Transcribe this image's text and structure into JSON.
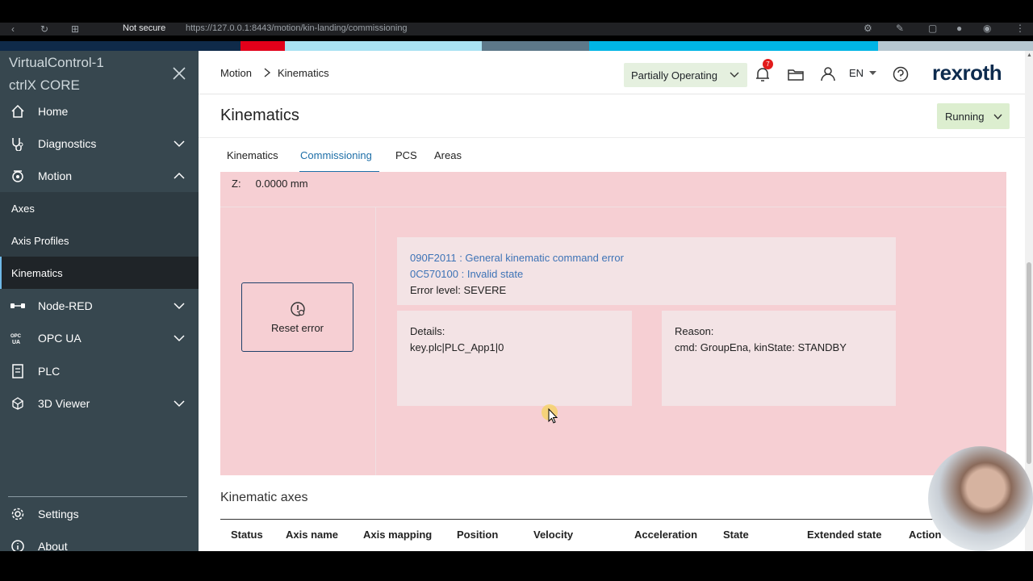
{
  "browser": {
    "secure_label": "Not secure",
    "url": "https://127.0.0.1:8443/motion/kin-landing/commissioning"
  },
  "sidebar": {
    "title_line1": "VirtualControl-1",
    "title_line2": "ctrlX CORE",
    "items": [
      {
        "label": "Home",
        "icon": "home-icon"
      },
      {
        "label": "Diagnostics",
        "icon": "stethoscope-icon"
      },
      {
        "label": "Motion",
        "icon": "motion-icon"
      },
      {
        "label": "Node-RED",
        "icon": "node-red-icon"
      },
      {
        "label": "OPC UA",
        "icon": "opc-ua-icon"
      },
      {
        "label": "PLC",
        "icon": "plc-icon"
      },
      {
        "label": "3D Viewer",
        "icon": "3d-viewer-icon"
      }
    ],
    "motion_sub": [
      "Axes",
      "Axis Profiles",
      "Kinematics"
    ],
    "footer": [
      {
        "label": "Settings",
        "icon": "gear-icon"
      },
      {
        "label": "About",
        "icon": "info-icon"
      }
    ]
  },
  "header": {
    "breadcrumb": [
      "Motion",
      "Kinematics"
    ],
    "operating_state": "Partially Operating",
    "notifications_count": "7",
    "language": "EN",
    "brand": "rexroth"
  },
  "page": {
    "title": "Kinematics",
    "run_state": "Running",
    "tabs": [
      "Kinematics",
      "Commissioning",
      "PCS",
      "Areas"
    ],
    "active_tab": "Commissioning"
  },
  "error_panel": {
    "z_label": "Z:",
    "z_value": "0.0000 mm",
    "reset_label": "Reset error",
    "error_main": "090F2011 : General kinematic command error",
    "error_sub": "0C570100 : Invalid state",
    "error_level": "Error level: SEVERE",
    "details_label": "Details:",
    "details_value": "key.plc|PLC_App1|0",
    "reason_label": "Reason:",
    "reason_value": "cmd: GroupEna, kinState: STANDBY"
  },
  "axes": {
    "title": "Kinematic axes",
    "columns": [
      "Status",
      "Axis name",
      "Axis mapping",
      "Position",
      "Velocity",
      "Acceleration",
      "State",
      "Extended state",
      "Action"
    ]
  },
  "colors": {
    "sidebar_bg": "#37474f",
    "error_bg": "#f6cfd3",
    "accent": "#1e6fa8",
    "running_bg": "#dceecf",
    "notification_badge": "#e21b1b"
  }
}
